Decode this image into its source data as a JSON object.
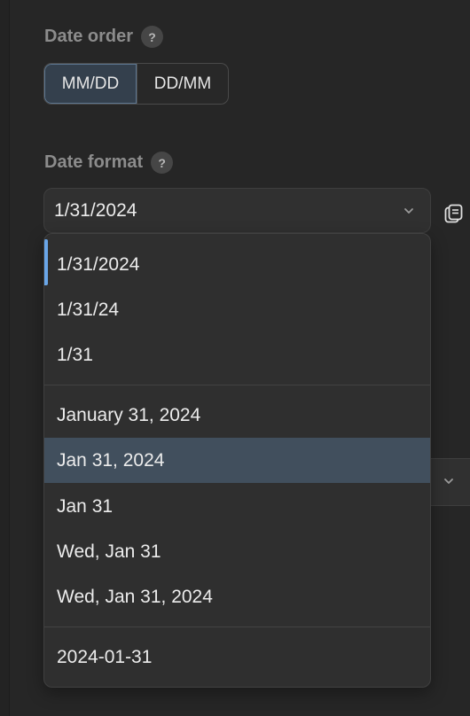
{
  "date_order": {
    "label": "Date order",
    "help": "?",
    "options": [
      "MM/DD",
      "DD/MM"
    ],
    "selected": "MM/DD"
  },
  "date_format": {
    "label": "Date format",
    "help": "?",
    "current_value": "1/31/2024",
    "groups": [
      [
        "1/31/2024",
        "1/31/24",
        "1/31"
      ],
      [
        "January 31, 2024",
        "Jan 31, 2024",
        "Jan 31",
        "Wed, Jan 31",
        "Wed, Jan 31, 2024"
      ],
      [
        "2024-01-31"
      ]
    ],
    "selected_option": "1/31/2024",
    "highlighted_option": "Jan 31, 2024"
  },
  "icons": {
    "help": "question-icon",
    "chevron": "chevron-down-icon",
    "copy": "copy-icon"
  },
  "colors": {
    "accent": "#6aa6e8",
    "highlight": "#414f5d",
    "background": "#262626"
  }
}
